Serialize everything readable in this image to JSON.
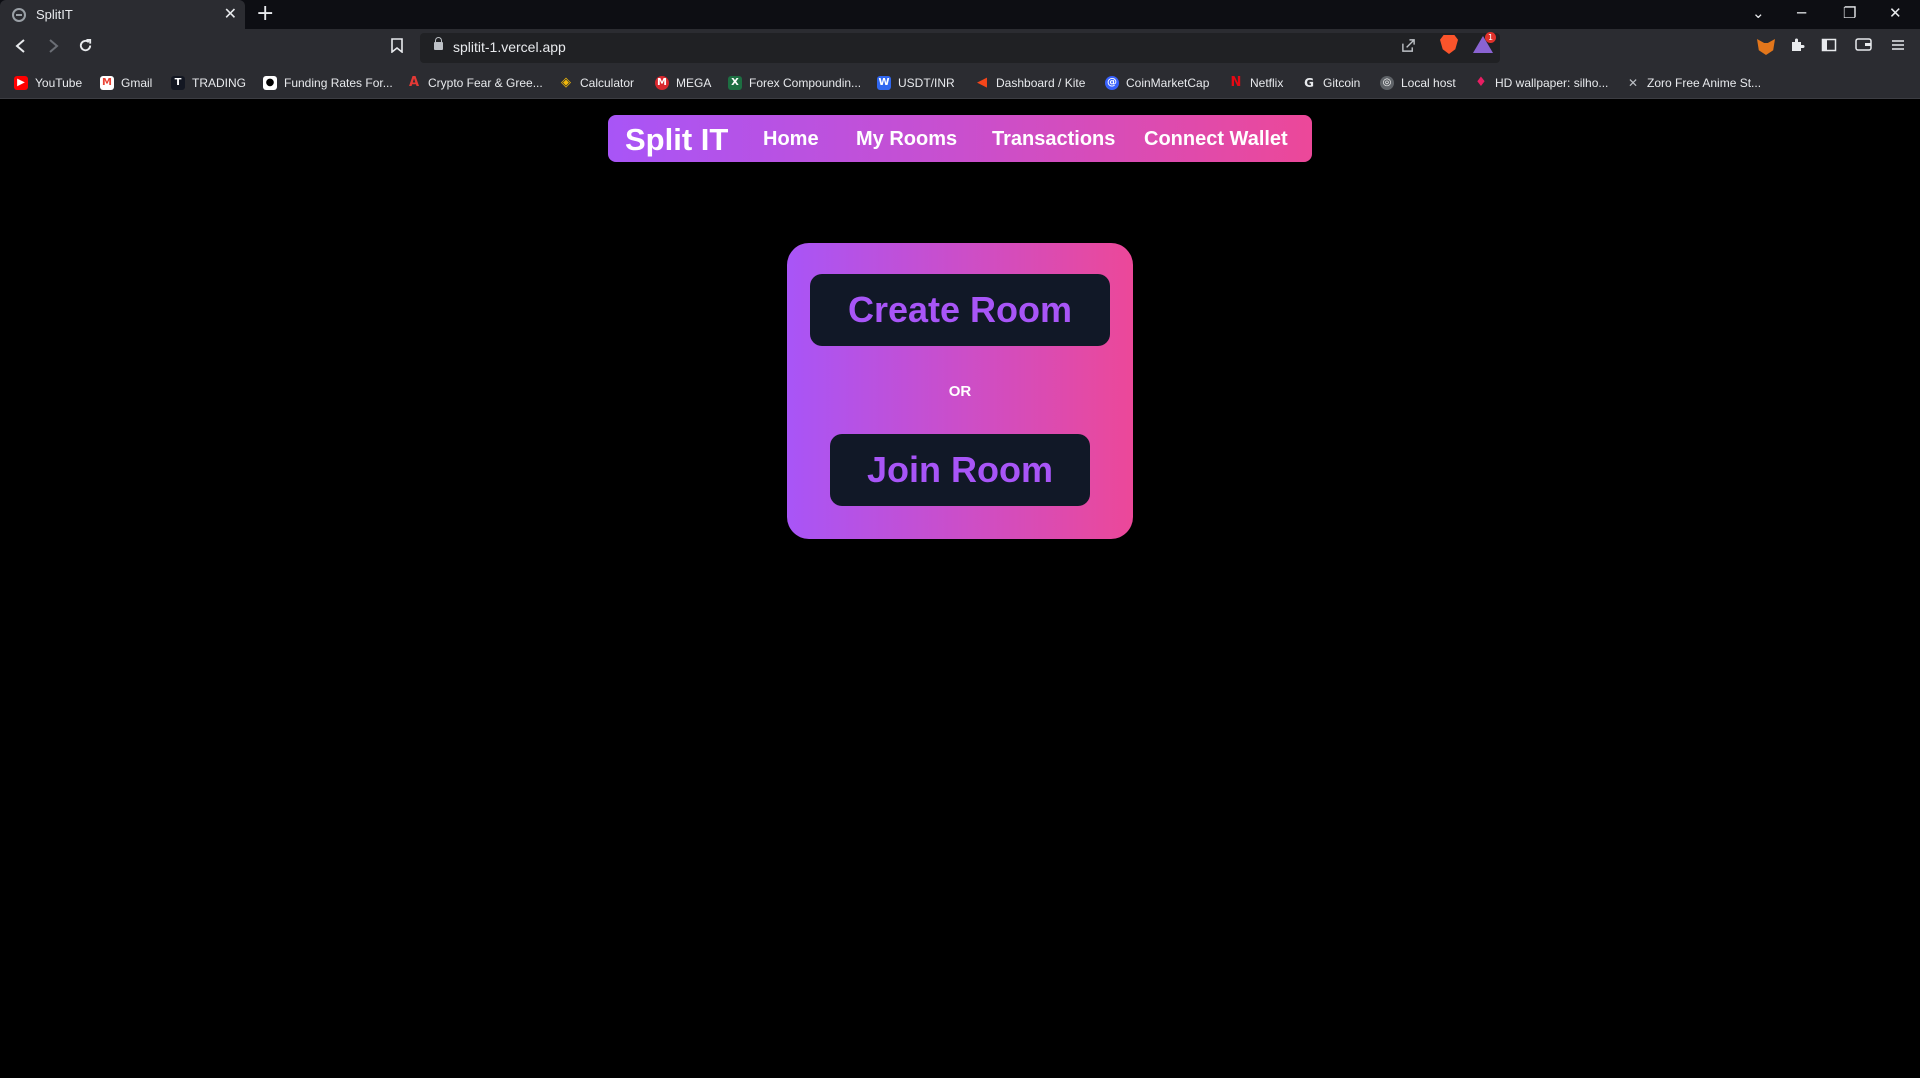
{
  "browser": {
    "tab_title": "SplitIT",
    "tab_close": "✕",
    "new_tab": "+",
    "url": "splitit-1.vercel.app",
    "window_controls": [
      "⌄",
      "─",
      "❐",
      "✕"
    ]
  },
  "bookmarks": [
    {
      "label": "YouTube",
      "icon": "youtube-icon",
      "color": "#ff0000"
    },
    {
      "label": "Gmail",
      "icon": "gmail-icon",
      "color": "#ea4335"
    },
    {
      "label": "TRADING",
      "icon": "tradingview-icon",
      "color": "#131722"
    },
    {
      "label": "Funding Rates For...",
      "icon": "shield-icon",
      "color": "#000000"
    },
    {
      "label": "Crypto Fear & Gree...",
      "icon": "alternative-icon",
      "color": "#e53935"
    },
    {
      "label": "Calculator",
      "icon": "binance-icon",
      "color": "#f0b90b"
    },
    {
      "label": "MEGA",
      "icon": "mega-icon",
      "color": "#d9272e"
    },
    {
      "label": "Forex Compoundin...",
      "icon": "excel-icon",
      "color": "#1d6f42"
    },
    {
      "label": "USDT/INR",
      "icon": "wazirx-icon",
      "color": "#3067f0"
    },
    {
      "label": "Dashboard / Kite",
      "icon": "kite-icon",
      "color": "#f6461a"
    },
    {
      "label": "CoinMarketCap",
      "icon": "coinmarketcap-icon",
      "color": "#3861fb"
    },
    {
      "label": "Netflix",
      "icon": "netflix-icon",
      "color": "#e50914"
    },
    {
      "label": "Gitcoin",
      "icon": "gitcoin-icon",
      "color": "#0e0333"
    },
    {
      "label": "Local host",
      "icon": "globe-icon",
      "color": "#5f6368"
    },
    {
      "label": "HD wallpaper: silho...",
      "icon": "wallpaper-icon",
      "color": "#c2185b"
    },
    {
      "label": "Zoro Free Anime St...",
      "icon": "zoro-icon",
      "color": "#2b2c31"
    }
  ],
  "navbar": {
    "brand": "Split IT",
    "links": [
      "Home",
      "My Rooms",
      "Transactions",
      "Connect Wallet"
    ]
  },
  "main": {
    "create_room": "Create Room",
    "or": "OR",
    "join_room": "Join Room"
  },
  "colors": {
    "gradient_start": "#a855f7",
    "gradient_end": "#ec4899",
    "button_bg": "#111827",
    "button_text": "#a855f7"
  }
}
